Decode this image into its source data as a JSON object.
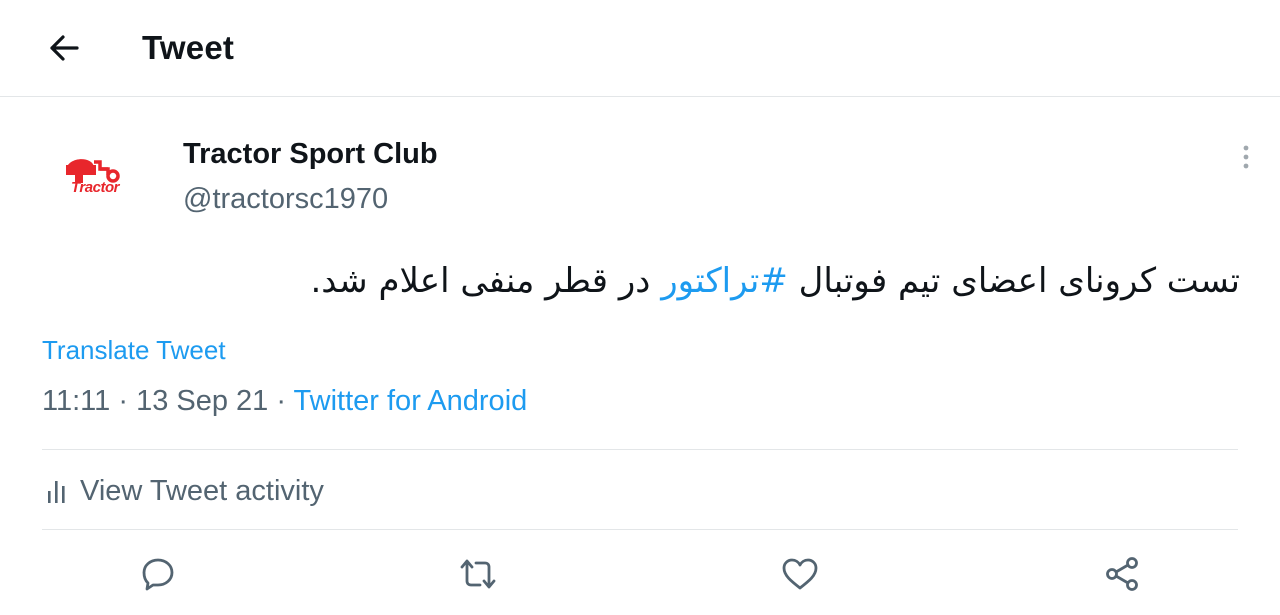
{
  "header": {
    "title": "Tweet",
    "back_icon": "arrow-left-icon"
  },
  "author": {
    "display_name": "Tractor Sport Club",
    "handle": "@tractorsc1970",
    "avatar_logo_text": "Tractor",
    "brand_color": "#e8262c"
  },
  "tweet": {
    "text_before": "تست کرونای اعضای تیم فوتبال ",
    "hashtag": "#تراکتور",
    "text_after": " در قطر منفی اعلام شد."
  },
  "translate_label": "Translate Tweet",
  "meta": {
    "time": "11:11",
    "separator": " · ",
    "date": "13 Sep 21",
    "source": "Twitter for Android"
  },
  "activity": {
    "label": "View Tweet activity",
    "icon": "bar-chart-icon"
  },
  "actions": {
    "reply_icon": "reply-icon",
    "retweet_icon": "retweet-icon",
    "like_icon": "heart-icon",
    "share_icon": "share-icon"
  },
  "colors": {
    "link": "#1d9bf0",
    "secondary_text": "#536471",
    "divider": "#e3e6e8"
  }
}
